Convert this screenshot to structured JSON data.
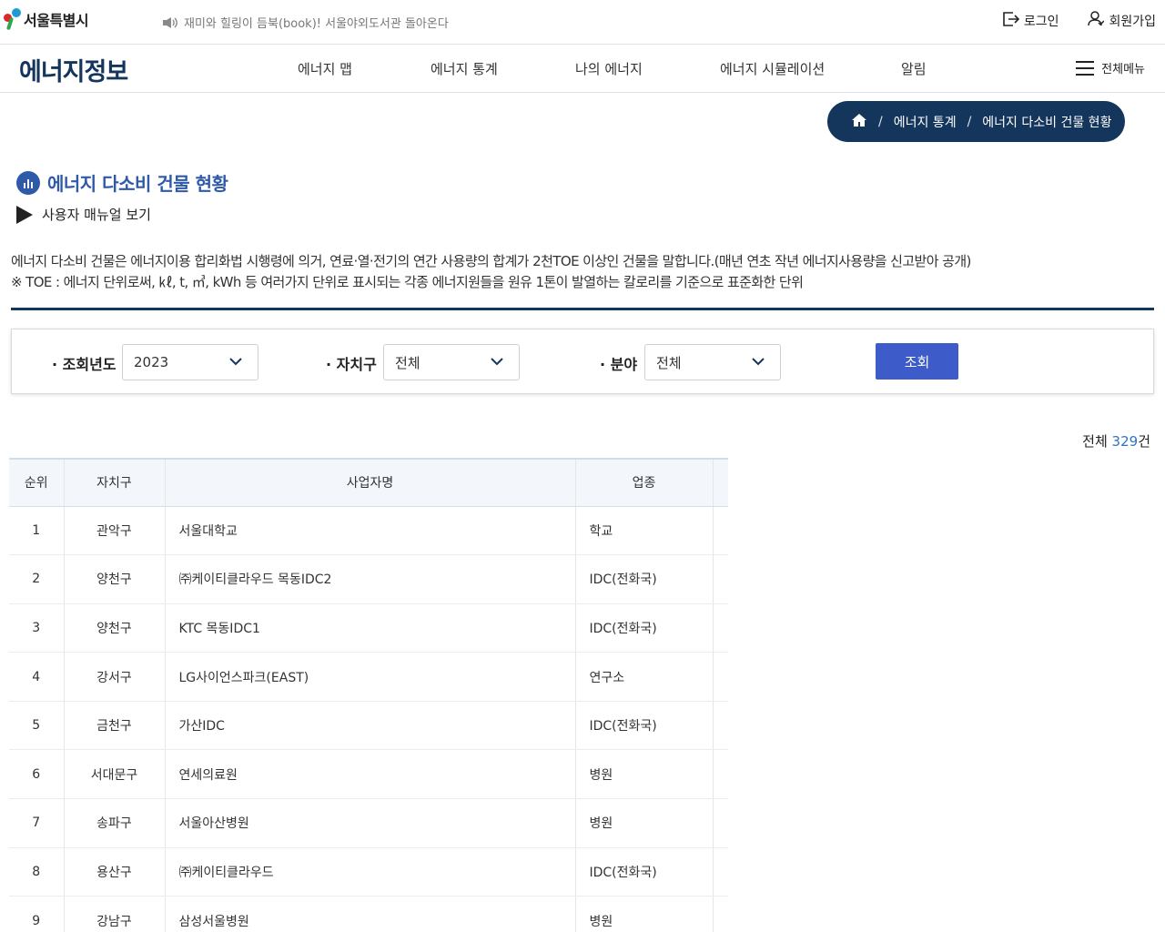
{
  "top": {
    "logo_text": "서울특별시",
    "notice": "재미와 힐링이 듬북(book)! 서울야외도서관 돌아온다",
    "login": "로그인",
    "signup": "회원가입"
  },
  "header": {
    "title": "에너지정보",
    "menu": [
      "에너지 맵",
      "에너지 통계",
      "나의 에너지",
      "에너지 시뮬레이션",
      "알림"
    ],
    "all_menu": "전체메뉴"
  },
  "breadcrumb": [
    "에너지 통계",
    "에너지 다소비 건물 현황"
  ],
  "page": {
    "title": "에너지 다소비 건물 현황",
    "manual": "사용자 매뉴얼 보기",
    "desc_line1": "에너지 다소비 건물은 에너지이용 합리화법 시행령에 의거, 연료·열·전기의 연간 사용량의 합계가 2천TOE 이상인 건물을 말합니다.(매년 연초 작년 에너지사용량을 신고받아 공개)",
    "desc_line2": "※ TOE : 에너지 단위로써, ㎘, t, ㎥, kWh 등 여러가지 단위로 표시되는 각종 에너지원들을 원유 1톤이 발열하는 칼로리를 기준으로 표준화한 단위"
  },
  "search": {
    "year_label": "조회년도",
    "year_value": "2023",
    "district_label": "자치구",
    "district_value": "전체",
    "field_label": "분야",
    "field_value": "전체",
    "submit": "조회"
  },
  "total": {
    "prefix": "전체",
    "count": "329",
    "suffix": "건"
  },
  "table": {
    "headers": [
      "순위",
      "자치구",
      "사업자명",
      "업종"
    ],
    "rows": [
      [
        "1",
        "관악구",
        "서울대학교",
        "학교"
      ],
      [
        "2",
        "양천구",
        "㈜케이티클라우드 목동IDC2",
        "IDC(전화국)"
      ],
      [
        "3",
        "양천구",
        "KTC 목동IDC1",
        "IDC(전화국)"
      ],
      [
        "4",
        "강서구",
        "LG사이언스파크(EAST)",
        "연구소"
      ],
      [
        "5",
        "금천구",
        "가산IDC",
        "IDC(전화국)"
      ],
      [
        "6",
        "서대문구",
        "연세의료원",
        "병원"
      ],
      [
        "7",
        "송파구",
        "서울아산병원",
        "병원"
      ],
      [
        "8",
        "용산구",
        "㈜케이티클라우드",
        "IDC(전화국)"
      ],
      [
        "9",
        "강남구",
        "삼성서울병원",
        "병원"
      ]
    ]
  }
}
